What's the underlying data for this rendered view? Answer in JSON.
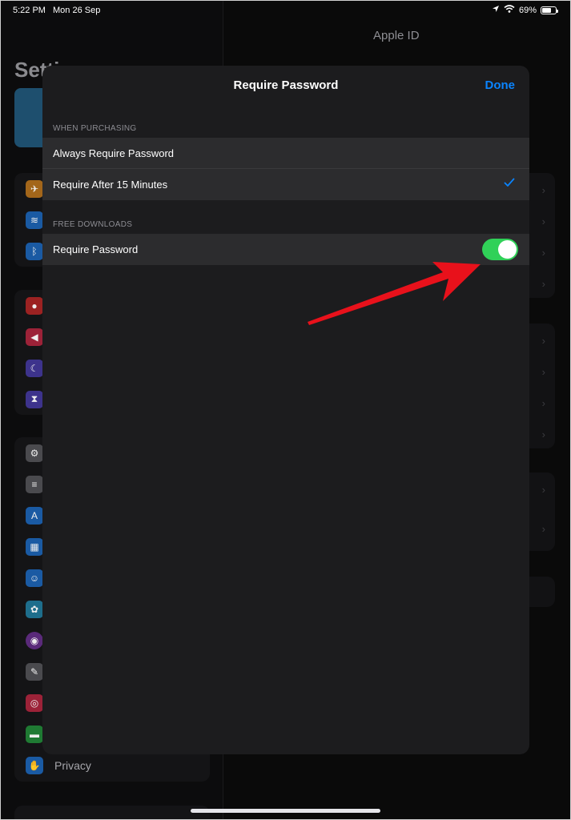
{
  "status_bar": {
    "time": "5:22 PM",
    "date": "Mon 26 Sep",
    "battery": "69%",
    "battery_level": 0.69
  },
  "background": {
    "settings_title": "Setti",
    "right_title": "Apple ID",
    "privacy_label": "Privacy"
  },
  "modal": {
    "title": "Require Password",
    "done_label": "Done",
    "sections": [
      {
        "header": "WHEN PURCHASING",
        "rows": [
          {
            "label": "Always Require Password",
            "checked": false
          },
          {
            "label": "Require After 15 Minutes",
            "checked": true
          }
        ]
      },
      {
        "header": "FREE DOWNLOADS",
        "rows": [
          {
            "label": "Require Password",
            "toggle": true
          }
        ]
      }
    ]
  },
  "icons": {
    "location": "location-arrow-icon",
    "wifi": "wifi-icon",
    "battery": "battery-icon",
    "checkmark": "checkmark-icon",
    "annotation_arrow": "red-arrow-icon"
  },
  "colors": {
    "accent": "#0a84ff",
    "toggle_on": "#30d158",
    "arrow": "#e8111b",
    "modal_bg": "#1c1c1e",
    "row_bg": "#2c2c2e"
  }
}
